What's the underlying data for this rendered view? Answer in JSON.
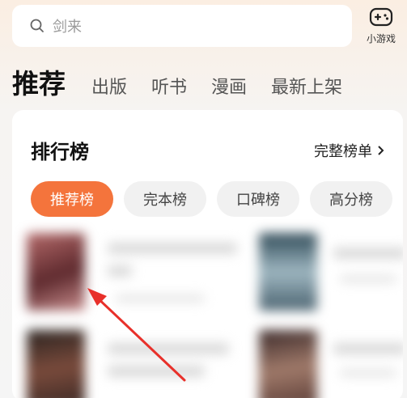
{
  "search": {
    "placeholder": "剑来"
  },
  "game": {
    "label": "小游戏",
    "icon": "gamepad-icon"
  },
  "nav": {
    "tabs": [
      "推荐",
      "出版",
      "听书",
      "漫画",
      "最新上架"
    ]
  },
  "ranking": {
    "title": "排行榜",
    "link": "完整榜单",
    "chips": [
      "推荐榜",
      "完本榜",
      "口碑榜",
      "高分榜"
    ]
  },
  "colors": {
    "accent": "#f4743c",
    "annotation": "#e8302a"
  }
}
